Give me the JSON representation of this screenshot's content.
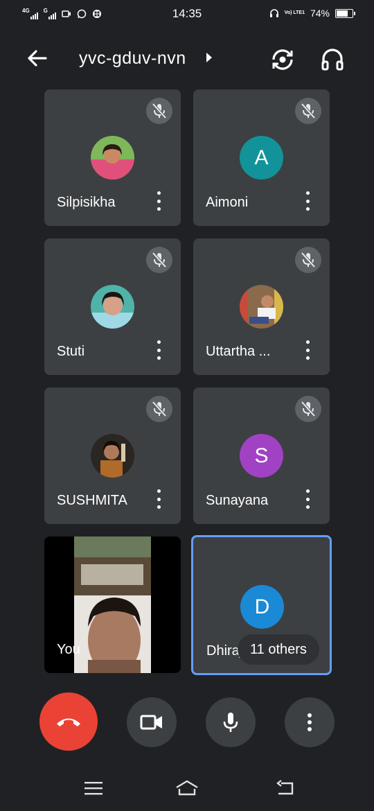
{
  "status_bar": {
    "network1": "4G",
    "network2": "G",
    "time": "14:35",
    "volte": "Vo) LTE1",
    "battery_text": "74%",
    "battery_level": 0.74
  },
  "header": {
    "meeting_code": "yvc-gduv-nvn"
  },
  "participants": [
    {
      "name": "Silpisikha",
      "muted": true,
      "avatar_type": "photo"
    },
    {
      "name": "Aimoni",
      "muted": true,
      "avatar_type": "initial",
      "initial": "A",
      "color": "#12939a"
    },
    {
      "name": "Stuti",
      "muted": true,
      "avatar_type": "photo"
    },
    {
      "name": "Uttartha ...",
      "muted": true,
      "avatar_type": "photo"
    },
    {
      "name": "SUSHMITA",
      "muted": true,
      "avatar_type": "photo"
    },
    {
      "name": "Sunayana",
      "muted": true,
      "avatar_type": "initial",
      "initial": "S",
      "color": "#a142c4"
    }
  ],
  "self_tile": {
    "name": "You"
  },
  "active_tile": {
    "name": "Dhiraj",
    "initial": "D",
    "color": "#1a8ad6",
    "others_label": "11 others"
  },
  "colors": {
    "background": "#202124",
    "tile": "#3c4043",
    "end_call": "#ea4335",
    "active_border": "#669df6"
  },
  "icons": [
    "back-arrow-icon",
    "switch-camera-icon",
    "headphones-icon",
    "mic-off-icon",
    "more-vert-icon",
    "call-end-icon",
    "videocam-icon",
    "mic-icon",
    "menu-icon",
    "home-icon",
    "back-icon"
  ]
}
